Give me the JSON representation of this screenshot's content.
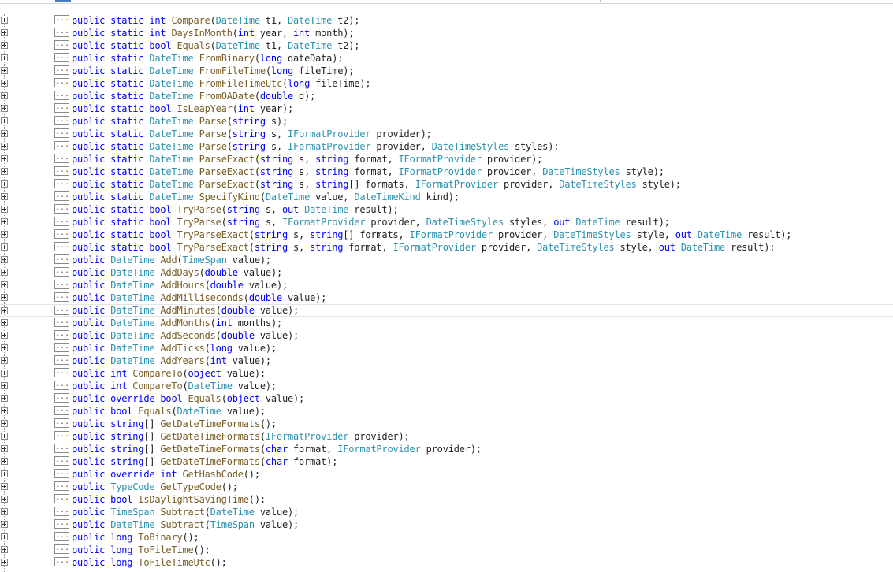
{
  "editor": {
    "collapsed_marker": "...",
    "lines": [
      [
        [
          "kw",
          "public static int "
        ],
        [
          "mt",
          "Compare"
        ],
        [
          "pn",
          "("
        ],
        [
          "tp",
          "DateTime"
        ],
        [
          "pn",
          " t1, "
        ],
        [
          "tp",
          "DateTime"
        ],
        [
          "pn",
          " t2);"
        ]
      ],
      [
        [
          "kw",
          "public static int "
        ],
        [
          "mt",
          "DaysInMonth"
        ],
        [
          "pn",
          "("
        ],
        [
          "kw",
          "int"
        ],
        [
          "pn",
          " year, "
        ],
        [
          "kw",
          "int"
        ],
        [
          "pn",
          " month);"
        ]
      ],
      [
        [
          "kw",
          "public static bool "
        ],
        [
          "mt",
          "Equals"
        ],
        [
          "pn",
          "("
        ],
        [
          "tp",
          "DateTime"
        ],
        [
          "pn",
          " t1, "
        ],
        [
          "tp",
          "DateTime"
        ],
        [
          "pn",
          " t2);"
        ]
      ],
      [
        [
          "kw",
          "public static "
        ],
        [
          "tp",
          "DateTime "
        ],
        [
          "mt",
          "FromBinary"
        ],
        [
          "pn",
          "("
        ],
        [
          "kw",
          "long"
        ],
        [
          "pn",
          " dateData);"
        ]
      ],
      [
        [
          "kw",
          "public static "
        ],
        [
          "tp",
          "DateTime "
        ],
        [
          "mt",
          "FromFileTime"
        ],
        [
          "pn",
          "("
        ],
        [
          "kw",
          "long"
        ],
        [
          "pn",
          " fileTime);"
        ]
      ],
      [
        [
          "kw",
          "public static "
        ],
        [
          "tp",
          "DateTime "
        ],
        [
          "mt",
          "FromFileTimeUtc"
        ],
        [
          "pn",
          "("
        ],
        [
          "kw",
          "long"
        ],
        [
          "pn",
          " fileTime);"
        ]
      ],
      [
        [
          "kw",
          "public static "
        ],
        [
          "tp",
          "DateTime "
        ],
        [
          "mt",
          "FromOADate"
        ],
        [
          "pn",
          "("
        ],
        [
          "kw",
          "double"
        ],
        [
          "pn",
          " d);"
        ]
      ],
      [
        [
          "kw",
          "public static bool "
        ],
        [
          "mt",
          "IsLeapYear"
        ],
        [
          "pn",
          "("
        ],
        [
          "kw",
          "int"
        ],
        [
          "pn",
          " year);"
        ]
      ],
      [
        [
          "kw",
          "public static "
        ],
        [
          "tp",
          "DateTime "
        ],
        [
          "mt",
          "Parse"
        ],
        [
          "pn",
          "("
        ],
        [
          "kw",
          "string"
        ],
        [
          "pn",
          " s);"
        ]
      ],
      [
        [
          "kw",
          "public static "
        ],
        [
          "tp",
          "DateTime "
        ],
        [
          "mt",
          "Parse"
        ],
        [
          "pn",
          "("
        ],
        [
          "kw",
          "string"
        ],
        [
          "pn",
          " s, "
        ],
        [
          "tp",
          "IFormatProvider"
        ],
        [
          "pn",
          " provider);"
        ]
      ],
      [
        [
          "kw",
          "public static "
        ],
        [
          "tp",
          "DateTime "
        ],
        [
          "mt",
          "Parse"
        ],
        [
          "pn",
          "("
        ],
        [
          "kw",
          "string"
        ],
        [
          "pn",
          " s, "
        ],
        [
          "tp",
          "IFormatProvider"
        ],
        [
          "pn",
          " provider, "
        ],
        [
          "tp",
          "DateTimeStyles"
        ],
        [
          "pn",
          " styles);"
        ]
      ],
      [
        [
          "kw",
          "public static "
        ],
        [
          "tp",
          "DateTime "
        ],
        [
          "mt",
          "ParseExact"
        ],
        [
          "pn",
          "("
        ],
        [
          "kw",
          "string"
        ],
        [
          "pn",
          " s, "
        ],
        [
          "kw",
          "string"
        ],
        [
          "pn",
          " format, "
        ],
        [
          "tp",
          "IFormatProvider"
        ],
        [
          "pn",
          " provider);"
        ]
      ],
      [
        [
          "kw",
          "public static "
        ],
        [
          "tp",
          "DateTime "
        ],
        [
          "mt",
          "ParseExact"
        ],
        [
          "pn",
          "("
        ],
        [
          "kw",
          "string"
        ],
        [
          "pn",
          " s, "
        ],
        [
          "kw",
          "string"
        ],
        [
          "pn",
          " format, "
        ],
        [
          "tp",
          "IFormatProvider"
        ],
        [
          "pn",
          " provider, "
        ],
        [
          "tp",
          "DateTimeStyles"
        ],
        [
          "pn",
          " style);"
        ]
      ],
      [
        [
          "kw",
          "public static "
        ],
        [
          "tp",
          "DateTime "
        ],
        [
          "mt",
          "ParseExact"
        ],
        [
          "pn",
          "("
        ],
        [
          "kw",
          "string"
        ],
        [
          "pn",
          " s, "
        ],
        [
          "kw",
          "string"
        ],
        [
          "pn",
          "[] formats, "
        ],
        [
          "tp",
          "IFormatProvider"
        ],
        [
          "pn",
          " provider, "
        ],
        [
          "tp",
          "DateTimeStyles"
        ],
        [
          "pn",
          " style);"
        ]
      ],
      [
        [
          "kw",
          "public static "
        ],
        [
          "tp",
          "DateTime "
        ],
        [
          "mt",
          "SpecifyKind"
        ],
        [
          "pn",
          "("
        ],
        [
          "tp",
          "DateTime"
        ],
        [
          "pn",
          " value, "
        ],
        [
          "tp",
          "DateTimeKind"
        ],
        [
          "pn",
          " kind);"
        ]
      ],
      [
        [
          "kw",
          "public static bool "
        ],
        [
          "mt",
          "TryParse"
        ],
        [
          "pn",
          "("
        ],
        [
          "kw",
          "string"
        ],
        [
          "pn",
          " s, "
        ],
        [
          "kw",
          "out "
        ],
        [
          "tp",
          "DateTime"
        ],
        [
          "pn",
          " result);"
        ]
      ],
      [
        [
          "kw",
          "public static bool "
        ],
        [
          "mt",
          "TryParse"
        ],
        [
          "pn",
          "("
        ],
        [
          "kw",
          "string"
        ],
        [
          "pn",
          " s, "
        ],
        [
          "tp",
          "IFormatProvider"
        ],
        [
          "pn",
          " provider, "
        ],
        [
          "tp",
          "DateTimeStyles"
        ],
        [
          "pn",
          " styles, "
        ],
        [
          "kw",
          "out "
        ],
        [
          "tp",
          "DateTime"
        ],
        [
          "pn",
          " result);"
        ]
      ],
      [
        [
          "kw",
          "public static bool "
        ],
        [
          "mt",
          "TryParseExact"
        ],
        [
          "pn",
          "("
        ],
        [
          "kw",
          "string"
        ],
        [
          "pn",
          " s, "
        ],
        [
          "kw",
          "string"
        ],
        [
          "pn",
          "[] formats, "
        ],
        [
          "tp",
          "IFormatProvider"
        ],
        [
          "pn",
          " provider, "
        ],
        [
          "tp",
          "DateTimeStyles"
        ],
        [
          "pn",
          " style, "
        ],
        [
          "kw",
          "out "
        ],
        [
          "tp",
          "DateTime"
        ],
        [
          "pn",
          " result);"
        ]
      ],
      [
        [
          "kw",
          "public static bool "
        ],
        [
          "mt",
          "TryParseExact"
        ],
        [
          "pn",
          "("
        ],
        [
          "kw",
          "string"
        ],
        [
          "pn",
          " s, "
        ],
        [
          "kw",
          "string"
        ],
        [
          "pn",
          " format, "
        ],
        [
          "tp",
          "IFormatProvider"
        ],
        [
          "pn",
          " provider, "
        ],
        [
          "tp",
          "DateTimeStyles"
        ],
        [
          "pn",
          " style, "
        ],
        [
          "kw",
          "out "
        ],
        [
          "tp",
          "DateTime"
        ],
        [
          "pn",
          " result);"
        ]
      ],
      [
        [
          "kw",
          "public "
        ],
        [
          "tp",
          "DateTime "
        ],
        [
          "mt",
          "Add"
        ],
        [
          "pn",
          "("
        ],
        [
          "tp",
          "TimeSpan"
        ],
        [
          "pn",
          " value);"
        ]
      ],
      [
        [
          "kw",
          "public "
        ],
        [
          "tp",
          "DateTime "
        ],
        [
          "mt",
          "AddDays"
        ],
        [
          "pn",
          "("
        ],
        [
          "kw",
          "double"
        ],
        [
          "pn",
          " value);"
        ]
      ],
      [
        [
          "kw",
          "public "
        ],
        [
          "tp",
          "DateTime "
        ],
        [
          "mt",
          "AddHours"
        ],
        [
          "pn",
          "("
        ],
        [
          "kw",
          "double"
        ],
        [
          "pn",
          " value);"
        ]
      ],
      [
        [
          "kw",
          "public "
        ],
        [
          "tp",
          "DateTime "
        ],
        [
          "mt",
          "AddMilliseconds"
        ],
        [
          "pn",
          "("
        ],
        [
          "kw",
          "double"
        ],
        [
          "pn",
          " value);"
        ]
      ],
      [
        [
          "kw",
          "public "
        ],
        [
          "tp",
          "DateTime "
        ],
        [
          "mt",
          "AddMinutes"
        ],
        [
          "pn",
          "("
        ],
        [
          "kw",
          "double"
        ],
        [
          "pn",
          " value);"
        ]
      ],
      [
        [
          "kw",
          "public "
        ],
        [
          "tp",
          "DateTime "
        ],
        [
          "mt",
          "AddMonths"
        ],
        [
          "pn",
          "("
        ],
        [
          "kw",
          "int"
        ],
        [
          "pn",
          " months);"
        ]
      ],
      [
        [
          "kw",
          "public "
        ],
        [
          "tp",
          "DateTime "
        ],
        [
          "mt",
          "AddSeconds"
        ],
        [
          "pn",
          "("
        ],
        [
          "kw",
          "double"
        ],
        [
          "pn",
          " value);"
        ]
      ],
      [
        [
          "kw",
          "public "
        ],
        [
          "tp",
          "DateTime "
        ],
        [
          "mt",
          "AddTicks"
        ],
        [
          "pn",
          "("
        ],
        [
          "kw",
          "long"
        ],
        [
          "pn",
          " value);"
        ]
      ],
      [
        [
          "kw",
          "public "
        ],
        [
          "tp",
          "DateTime "
        ],
        [
          "mt",
          "AddYears"
        ],
        [
          "pn",
          "("
        ],
        [
          "kw",
          "int"
        ],
        [
          "pn",
          " value);"
        ]
      ],
      [
        [
          "kw",
          "public int "
        ],
        [
          "mt",
          "CompareTo"
        ],
        [
          "pn",
          "("
        ],
        [
          "kw",
          "object"
        ],
        [
          "pn",
          " value);"
        ]
      ],
      [
        [
          "kw",
          "public int "
        ],
        [
          "mt",
          "CompareTo"
        ],
        [
          "pn",
          "("
        ],
        [
          "tp",
          "DateTime"
        ],
        [
          "pn",
          " value);"
        ]
      ],
      [
        [
          "kw",
          "public override bool "
        ],
        [
          "mt",
          "Equals"
        ],
        [
          "pn",
          "("
        ],
        [
          "kw",
          "object"
        ],
        [
          "pn",
          " value);"
        ]
      ],
      [
        [
          "kw",
          "public bool "
        ],
        [
          "mt",
          "Equals"
        ],
        [
          "pn",
          "("
        ],
        [
          "tp",
          "DateTime"
        ],
        [
          "pn",
          " value);"
        ]
      ],
      [
        [
          "kw",
          "public string"
        ],
        [
          "pn",
          "[] "
        ],
        [
          "mt",
          "GetDateTimeFormats"
        ],
        [
          "pn",
          "();"
        ]
      ],
      [
        [
          "kw",
          "public string"
        ],
        [
          "pn",
          "[] "
        ],
        [
          "mt",
          "GetDateTimeFormats"
        ],
        [
          "pn",
          "("
        ],
        [
          "tp",
          "IFormatProvider"
        ],
        [
          "pn",
          " provider);"
        ]
      ],
      [
        [
          "kw",
          "public string"
        ],
        [
          "pn",
          "[] "
        ],
        [
          "mt",
          "GetDateTimeFormats"
        ],
        [
          "pn",
          "("
        ],
        [
          "kw",
          "char"
        ],
        [
          "pn",
          " format, "
        ],
        [
          "tp",
          "IFormatProvider"
        ],
        [
          "pn",
          " provider);"
        ]
      ],
      [
        [
          "kw",
          "public string"
        ],
        [
          "pn",
          "[] "
        ],
        [
          "mt",
          "GetDateTimeFormats"
        ],
        [
          "pn",
          "("
        ],
        [
          "kw",
          "char"
        ],
        [
          "pn",
          " format);"
        ]
      ],
      [
        [
          "kw",
          "public override int "
        ],
        [
          "mt",
          "GetHashCode"
        ],
        [
          "pn",
          "();"
        ]
      ],
      [
        [
          "kw",
          "public "
        ],
        [
          "tp",
          "TypeCode "
        ],
        [
          "mt",
          "GetTypeCode"
        ],
        [
          "pn",
          "();"
        ]
      ],
      [
        [
          "kw",
          "public bool "
        ],
        [
          "mt",
          "IsDaylightSavingTime"
        ],
        [
          "pn",
          "();"
        ]
      ],
      [
        [
          "kw",
          "public "
        ],
        [
          "tp",
          "TimeSpan "
        ],
        [
          "mt",
          "Subtract"
        ],
        [
          "pn",
          "("
        ],
        [
          "tp",
          "DateTime"
        ],
        [
          "pn",
          " value);"
        ]
      ],
      [
        [
          "kw",
          "public "
        ],
        [
          "tp",
          "DateTime "
        ],
        [
          "mt",
          "Subtract"
        ],
        [
          "pn",
          "("
        ],
        [
          "tp",
          "TimeSpan"
        ],
        [
          "pn",
          " value);"
        ]
      ],
      [
        [
          "kw",
          "public long "
        ],
        [
          "mt",
          "ToBinary"
        ],
        [
          "pn",
          "();"
        ]
      ],
      [
        [
          "kw",
          "public long "
        ],
        [
          "mt",
          "ToFileTime"
        ],
        [
          "pn",
          "();"
        ]
      ],
      [
        [
          "kw",
          "public long "
        ],
        [
          "mt",
          "ToFileTimeUtc"
        ],
        [
          "pn",
          "();"
        ]
      ]
    ],
    "current_line_index": 23
  },
  "colors": {
    "keyword": "#0000ff",
    "type": "#2b91af",
    "method": "#795e26",
    "text": "#222222",
    "background": "#ffffff"
  },
  "icons": {
    "fold": "plus-box-icon"
  }
}
